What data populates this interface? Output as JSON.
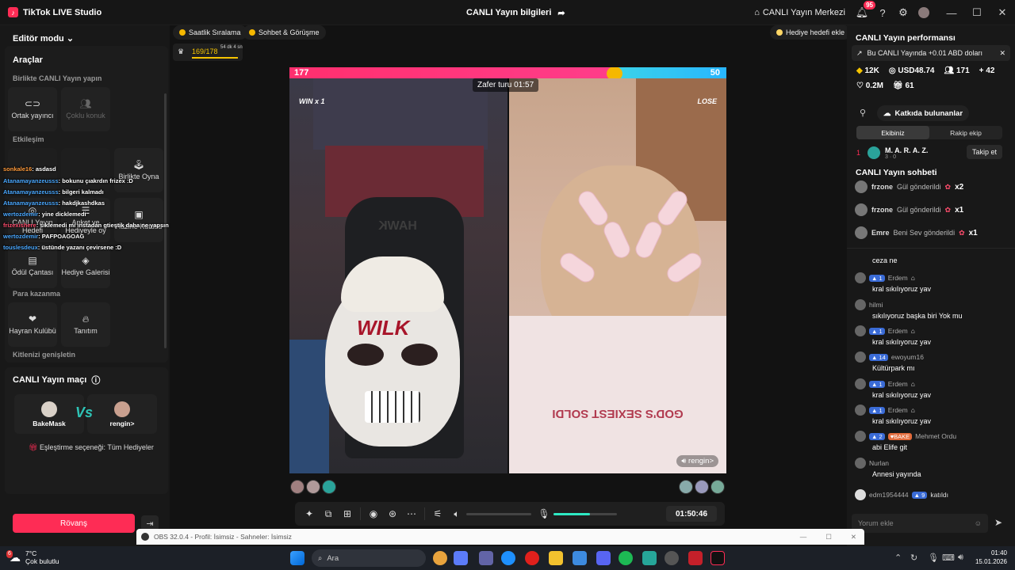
{
  "titlebar": {
    "app": "TikTok LIVE Studio",
    "center_title": "CANLI Yayın bilgileri",
    "live_center": "CANLI Yayın Merkezi",
    "notif_count": "95"
  },
  "left": {
    "mode": "Editör modu",
    "tools": "Araçlar",
    "sec_together": "Birlikte CANLI Yayın yapın",
    "tile_cohost": "Ortak yayıncı",
    "tile_multi": "Çoklu konuk",
    "sec_interact": "Etkileşim",
    "tile_play": "Birlikte Oyna",
    "tile_goal": "CANLI Yayın Hedefi",
    "tile_poll": "Anket ve Hediyeyle oy",
    "tile_treasure": "Hazine Kutusu",
    "tile_prize": "Ödül Çantası",
    "tile_gallery": "Hediye Galerisi",
    "sec_earn": "Para kazanma",
    "tile_fan": "Hayran Kulübü",
    "tile_promo": "Tanıtım",
    "sec_grow": "Kitlenizi genişletin",
    "match_title": "CANLI Yayın maçı",
    "player1": "BakeMask",
    "player2": "rengin>",
    "vs": "Vs",
    "pairing": "Eşleştirme seçeneği: Tüm Hediyeler",
    "rematch": "Rövanş"
  },
  "overlay_chat": [
    {
      "u": "sonkale16",
      "t": ": asdasd"
    },
    {
      "u": "Atanamayanzeusss",
      "t": ": bokunu çıakrdın frizex :D"
    },
    {
      "u": "Atanamayanzeusss",
      "t": ": bilgeri kalmadı"
    },
    {
      "u": "Atanamayanzeusss",
      "t": ": hakdjkashdkas"
    },
    {
      "u": "wertozdemir",
      "t": ": yine dicklemedi"
    },
    {
      "u": "frizexishere",
      "t": ": siklemedi mi instadan gtieştik daha ne yapsın"
    },
    {
      "u": "wertozdemir",
      "t": ": PAFPOAGOAG"
    },
    {
      "u": "touslesdeux",
      "t": ": üstünde yazanı çevirsene :D"
    }
  ],
  "stage": {
    "pill1": "Saatlik Sıralama",
    "pill2": "Sohbet & Görüşme",
    "pill3": "Hediye hedefi ekle",
    "score": "169/178",
    "score_sub": "54 dk 4 sn",
    "pk_left": "177",
    "pk_right": "50",
    "pk_left_fraction": 0.745,
    "win": "WIN x 1",
    "lose": "LOSE",
    "timer": "Zafer turu 01:57",
    "opponent": "rengin>",
    "clock": "01:50:46",
    "shirt_text": "GOD'S SEXIEST SOLDI",
    "chair_text": "HAWK",
    "mask_text": "WILK",
    "volume_fraction": 0.0,
    "mic_fraction": 0.58
  },
  "right": {
    "perf_title": "CANLI Yayın performansı",
    "banner": "Bu CANLI Yayında +0.01 ABD doları",
    "s1": "12K",
    "s2": "USD48.74",
    "s3": "171",
    "s4": "42",
    "s5": "0.2M",
    "s6": "61",
    "contrib_btn": "Katkıda bulunanlar",
    "tab1": "Ekibiniz",
    "tab2": "Rakip ekip",
    "rank": "1",
    "contrib_name": "M. A. R. A. Z.",
    "contrib_sub": "3 · 0",
    "follow": "Takip et",
    "chat_title": "CANLI Yayın sohbeti",
    "gifts": [
      {
        "n": "frzone",
        "a": "Gül gönderildi",
        "c": "x2"
      },
      {
        "n": "frzone",
        "a": "Gül gönderildi",
        "c": "x1"
      },
      {
        "n": "Emre",
        "a": "Beni Sev gönderildi",
        "c": "x1"
      }
    ],
    "messages": [
      {
        "user": "",
        "lvl": "",
        "text": "ceza ne"
      },
      {
        "user": "Erdem",
        "lvl": "1",
        "text": "kral sıkılıyoruz yav"
      },
      {
        "user": "hilmi",
        "lvl": "",
        "text": "sıkılıyoruz başka biri Yok mu"
      },
      {
        "user": "Erdem",
        "lvl": "1",
        "text": "kral sıkılıyoruz yav"
      },
      {
        "user": "ewoyum16",
        "lvl": "14",
        "text": "Kültürpark mı"
      },
      {
        "user": "Erdem",
        "lvl": "1",
        "text": "kral sıkılıyoruz yav"
      },
      {
        "user": "Erdem",
        "lvl": "1",
        "text": "kral sıkılıyoruz yav"
      },
      {
        "user": "Mehmet Ordu",
        "lvl": "2",
        "text": "abi Elife git"
      },
      {
        "user": "Nurlan",
        "lvl": "",
        "text": "Annesi yayında"
      }
    ],
    "join_user": "edm1954444",
    "join_lvl": "9",
    "join_text": "katıldı",
    "bake_badge": "BAKE",
    "input_placeholder": "Yorum ekle"
  },
  "obs": {
    "title": "OBS 32.0.4 - Profil: İsimsiz - Sahneler: İsimsiz"
  },
  "taskbar": {
    "temp": "7°C",
    "weather": "Çok bulutlu",
    "weather_badge": "6",
    "search": "Ara",
    "time": "01:40",
    "date": "15.01.2026"
  }
}
